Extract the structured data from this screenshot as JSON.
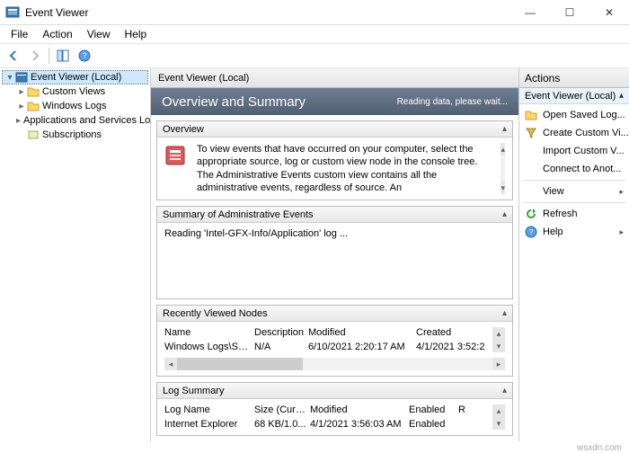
{
  "window": {
    "title": "Event Viewer"
  },
  "menu": {
    "file": "File",
    "action": "Action",
    "view": "View",
    "help": "Help"
  },
  "tree": {
    "root": "Event Viewer (Local)",
    "items": [
      "Custom Views",
      "Windows Logs",
      "Applications and Services Lo",
      "Subscriptions"
    ]
  },
  "center": {
    "header": "Event Viewer (Local)",
    "banner_title": "Overview and Summary",
    "banner_status": "Reading data, please wait...",
    "overview_panel": {
      "title": "Overview",
      "text": "To view events that have occurred on your computer, select the appropriate source, log or custom view node in the console tree. The Administrative Events custom view contains all the administrative events, regardless of source. An"
    },
    "admin_panel": {
      "title": "Summary of Administrative Events",
      "status": "Reading 'Intel-GFX-Info/Application' log ..."
    },
    "recent_panel": {
      "title": "Recently Viewed Nodes",
      "cols": [
        "Name",
        "Description",
        "Modified",
        "Created"
      ],
      "row": [
        "Windows Logs\\System",
        "N/A",
        "6/10/2021 2:20:17 AM",
        "4/1/2021 3:52:2"
      ]
    },
    "log_panel": {
      "title": "Log Summary",
      "cols": [
        "Log Name",
        "Size (Curr...",
        "Modified",
        "Enabled",
        "R"
      ],
      "row": [
        "Internet Explorer",
        "68 KB/1.0...",
        "4/1/2021 3:56:03 AM",
        "Enabled",
        ""
      ]
    }
  },
  "actions": {
    "header": "Actions",
    "sub": "Event Viewer (Local)",
    "items": [
      "Open Saved Log...",
      "Create Custom Vi...",
      "Import Custom V...",
      "Connect to Anot...",
      "View",
      "Refresh",
      "Help"
    ]
  },
  "watermark": "wsxdn.com"
}
